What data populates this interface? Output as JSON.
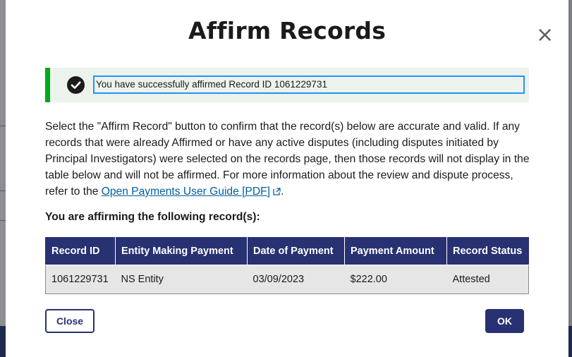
{
  "modal": {
    "title": "Affirm Records",
    "close_icon": "close-icon"
  },
  "alert": {
    "icon": "check-circle-icon",
    "message": "You have successfully affirmed Record ID 1061229731"
  },
  "description": {
    "text": "Select the \"Affirm Record\" button to confirm that the record(s) below are accurate and valid. If any records that were already Affirmed or have any active disputes (including disputes initiated by Principal Investigators) were selected on the records page, then those records will not display in the table below and will not be affirmed. For more information about the review and dispute process, refer to the ",
    "link_text": "Open Payments User Guide [PDF]",
    "link_icon": "external-link-icon",
    "suffix": "."
  },
  "subheading": "You are affirming the following record(s):",
  "table": {
    "headers": [
      "Record ID",
      "Entity Making Payment",
      "Date of Payment",
      "Payment Amount",
      "Record Status"
    ],
    "rows": [
      [
        "1061229731",
        "NS Entity",
        "03/09/2023",
        "$222.00",
        "Attested"
      ]
    ]
  },
  "buttons": {
    "close_label": "Close",
    "ok_label": "OK"
  },
  "colors": {
    "primary": "#283172",
    "success": "#00a91c",
    "link": "#005ea2",
    "focus": "#2491ff"
  }
}
